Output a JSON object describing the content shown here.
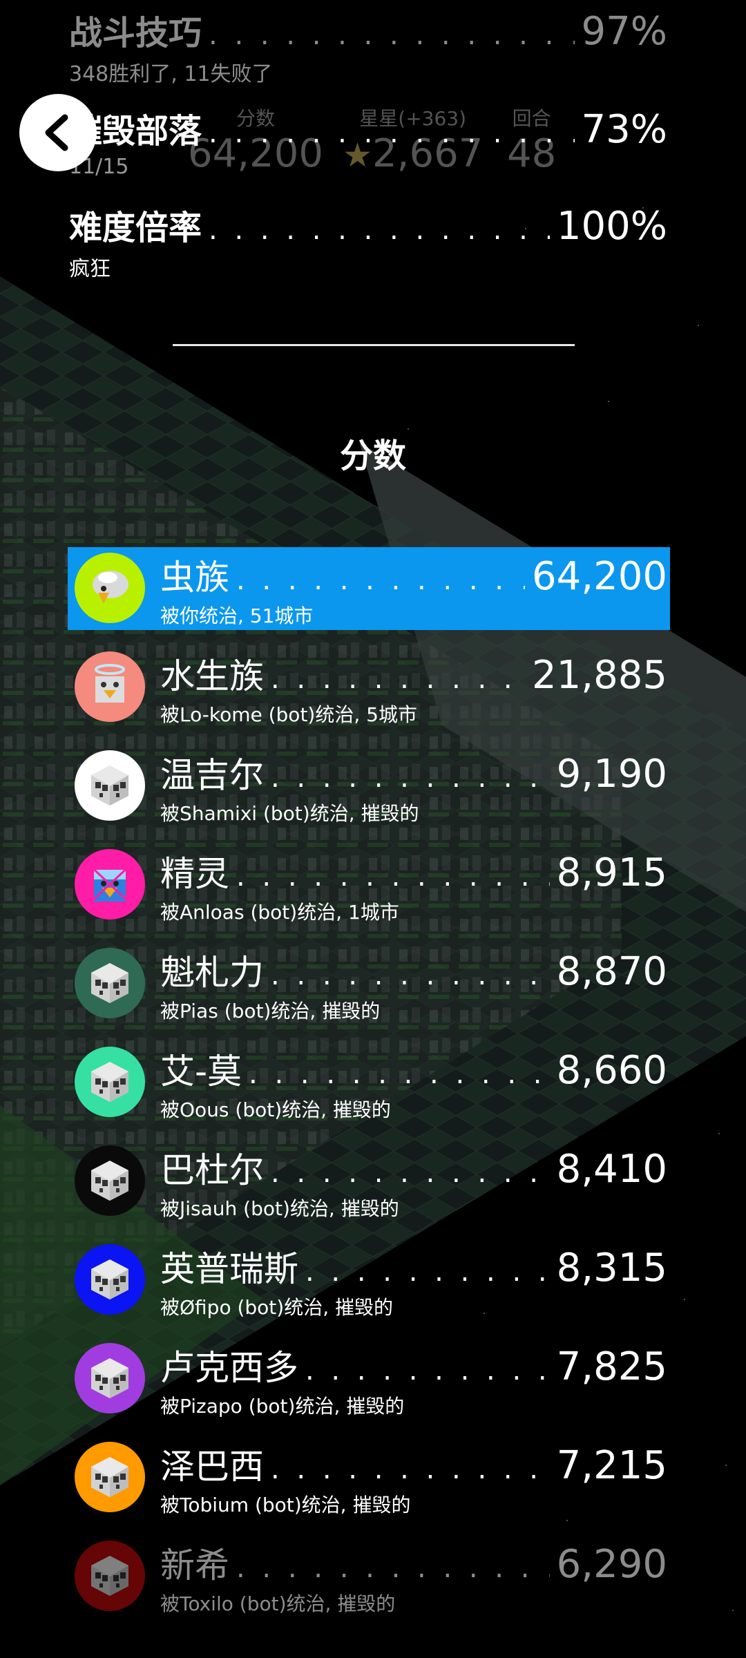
{
  "stats": [
    {
      "name": "战斗技巧",
      "value": "97%",
      "sub": "348胜利了, 11失败了"
    },
    {
      "name": "摧毁部落",
      "value": "73%",
      "sub": "11/15"
    },
    {
      "name": "难度倍率",
      "value": "100%",
      "sub": "疯狂"
    }
  ],
  "ghost_header": {
    "score_label": "分数",
    "score_value": "64,200",
    "stars_label": "星星(+363)",
    "stars_value": "2,667",
    "turn_label": "回合",
    "turn_value": "48"
  },
  "section_title": "分数",
  "tribes": [
    {
      "name": "虫族",
      "score": "64,200",
      "sub": "被你统治, 51城市",
      "color": "#b8f000",
      "highlight": true
    },
    {
      "name": "水生族",
      "score": "21,885",
      "sub": "被Lo-kome (bot)统治, 5城市",
      "color": "#f58a7e"
    },
    {
      "name": "温吉尔",
      "score": "9,190",
      "sub": "被Shamixi (bot)统治, 摧毁的",
      "color": "#ffffff"
    },
    {
      "name": "精灵",
      "score": "8,915",
      "sub": "被Anloas (bot)统治, 1城市",
      "color": "#ff1ca6"
    },
    {
      "name": "魁札力",
      "score": "8,870",
      "sub": "被Pias (bot)统治, 摧毁的",
      "color": "#2f6b54"
    },
    {
      "name": "艾-莫",
      "score": "8,660",
      "sub": "被Oous (bot)统治, 摧毁的",
      "color": "#36e0a2"
    },
    {
      "name": "巴杜尔",
      "score": "8,410",
      "sub": "被Jisauh (bot)统治, 摧毁的",
      "color": "#0a0a0a"
    },
    {
      "name": "英普瑞斯",
      "score": "8,315",
      "sub": "被Øfipo (bot)统治, 摧毁的",
      "color": "#0b14f2"
    },
    {
      "name": "卢克西多",
      "score": "7,825",
      "sub": "被Pizapo (bot)统治, 摧毁的",
      "color": "#a13de0"
    },
    {
      "name": "泽巴西",
      "score": "7,215",
      "sub": "被Tobium (bot)统治, 摧毁的",
      "color": "#ff9a00"
    },
    {
      "name": "新希",
      "score": "6,290",
      "sub": "被Toxilo (bot)统治, 摧毁的",
      "color": "#b80a0a",
      "faded": true
    }
  ],
  "icons": {
    "back": "chevron-left-icon",
    "tribe_destroyed": "skull-cube-icon"
  }
}
